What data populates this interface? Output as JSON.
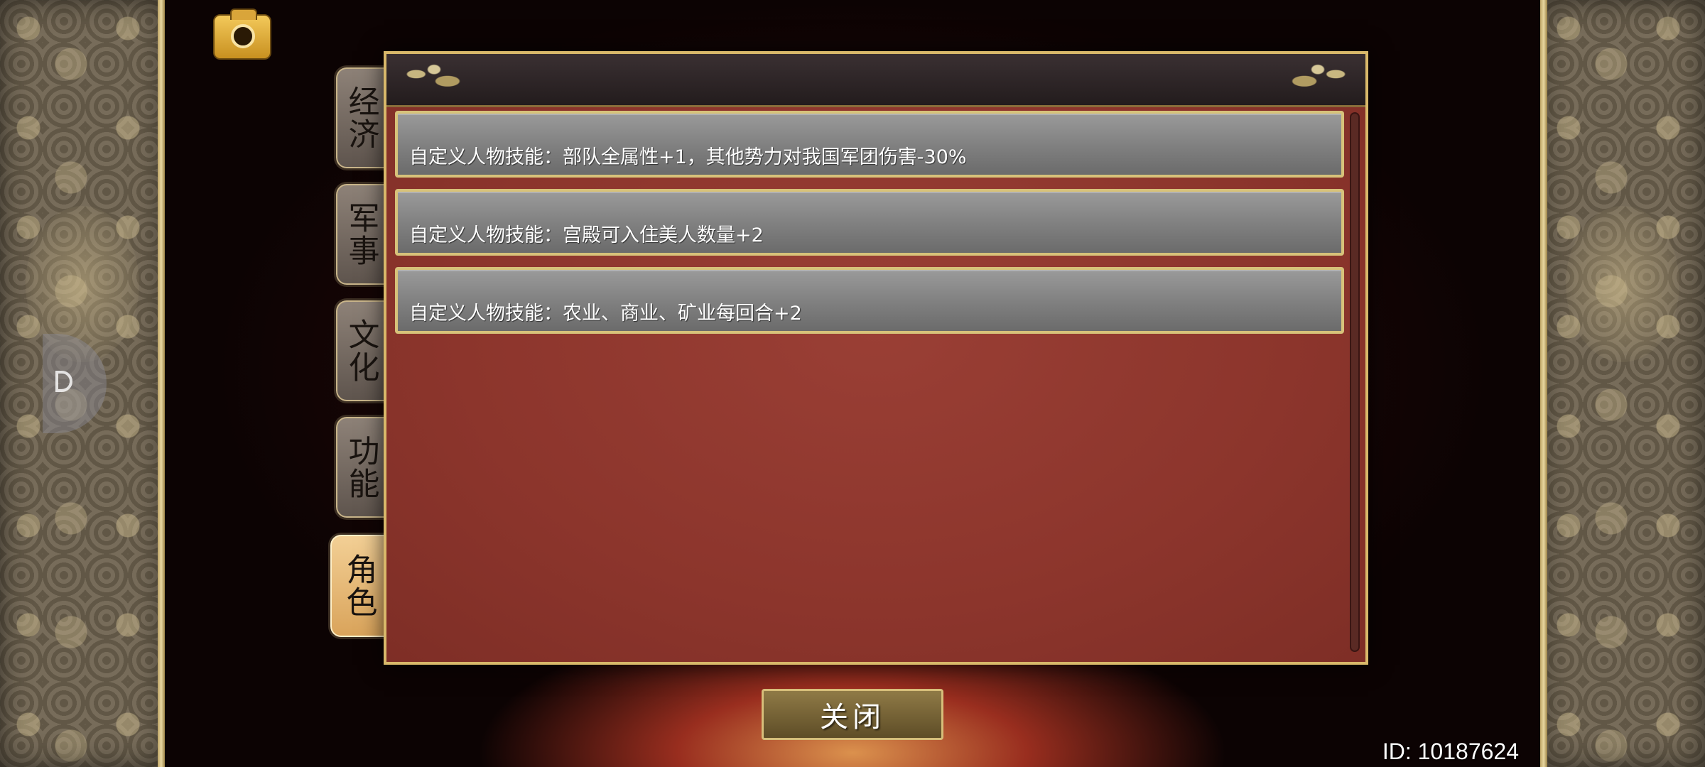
{
  "tabs": [
    {
      "id": "economy",
      "label": "经济",
      "active": false
    },
    {
      "id": "military",
      "label": "军事",
      "active": false
    },
    {
      "id": "culture",
      "label": "文化",
      "active": false
    },
    {
      "id": "function",
      "label": "功能",
      "active": false
    },
    {
      "id": "character",
      "label": "角色",
      "active": true
    }
  ],
  "skills": [
    {
      "text": "自定义人物技能：部队全属性+1，其他势力对我国军团伤害-30%"
    },
    {
      "text": "自定义人物技能：宫殿可入住美人数量+2"
    },
    {
      "text": "自定义人物技能：农业、商业、矿业每回合+2"
    }
  ],
  "close_label": "关闭",
  "player_id": "ID: 10187624",
  "icons": {
    "camera": "camera-icon",
    "floating_handle": "floating-menu-icon"
  },
  "colors": {
    "dialog_border": "#d8b86a",
    "dialog_body": "#8c352c",
    "skill_item_bg": "#8a8a8a",
    "active_tab": "#e8b974",
    "inactive_tab": "#766a62"
  }
}
